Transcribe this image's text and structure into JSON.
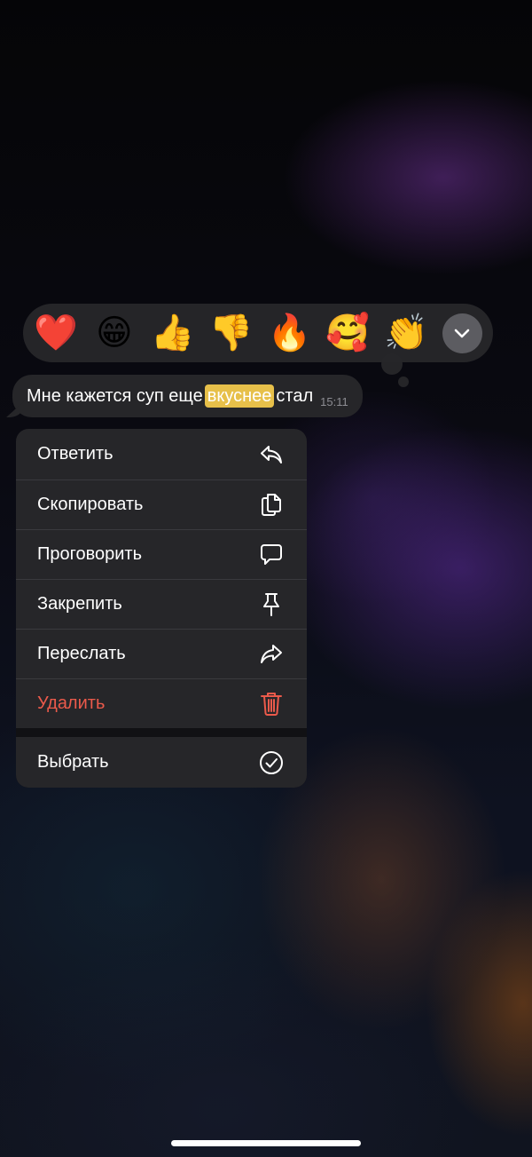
{
  "reactions": [
    {
      "emoji": "❤️",
      "name": "red-heart"
    },
    {
      "emoji": "😁",
      "name": "grinning-face"
    },
    {
      "emoji": "👍",
      "name": "thumbs-up"
    },
    {
      "emoji": "👎",
      "name": "thumbs-down"
    },
    {
      "emoji": "🔥",
      "name": "fire"
    },
    {
      "emoji": "🥰",
      "name": "smiling-face-with-hearts"
    },
    {
      "emoji": "👏",
      "name": "clapping-hands"
    }
  ],
  "message": {
    "text_before": "Мне кажется суп еще",
    "highlighted": "вкуснее",
    "text_after": "стал",
    "time": "15:11"
  },
  "menu": {
    "reply": "Ответить",
    "copy": "Скопировать",
    "speak": "Проговорить",
    "pin": "Закрепить",
    "forward": "Переслать",
    "delete": "Удалить",
    "select": "Выбрать"
  },
  "colors": {
    "danger": "#eb5a4b",
    "highlight": "#e7c04a",
    "menu_bg": "#262629"
  }
}
